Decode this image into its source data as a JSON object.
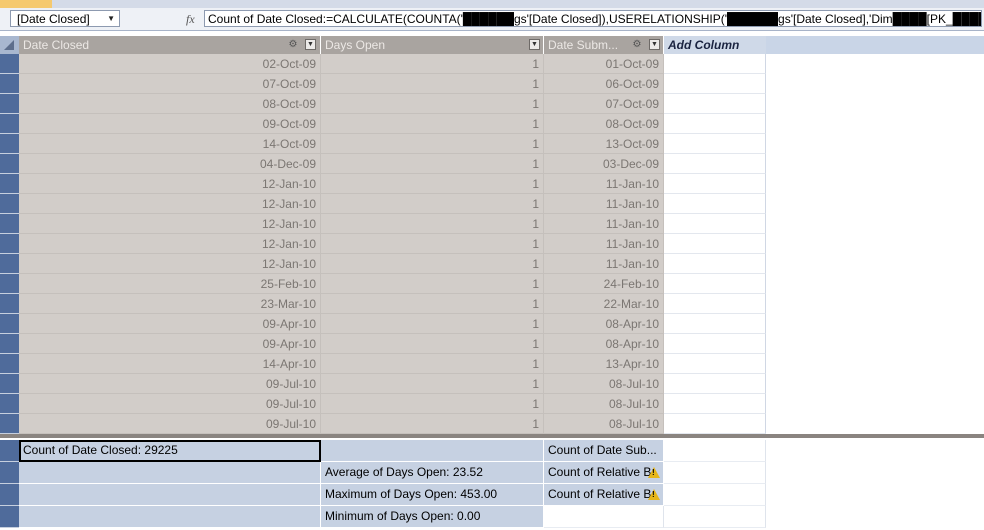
{
  "formula_bar": {
    "name_box": "[Date Closed]",
    "fx_label": "fx",
    "formula": "Count of Date Closed:=CALCULATE(COUNTA('██████gs'[Date Closed]),USERELATIONSHIP('██████gs'[Date Closed],'Dim████[PK_████]))"
  },
  "columns": [
    {
      "label": "Date Closed"
    },
    {
      "label": "Days Open"
    },
    {
      "label": "Date Subm..."
    },
    {
      "label": "Add Column"
    }
  ],
  "rows": [
    {
      "date_closed": "02-Oct-09",
      "days_open": "1",
      "date_submitted": "01-Oct-09"
    },
    {
      "date_closed": "07-Oct-09",
      "days_open": "1",
      "date_submitted": "06-Oct-09"
    },
    {
      "date_closed": "08-Oct-09",
      "days_open": "1",
      "date_submitted": "07-Oct-09"
    },
    {
      "date_closed": "09-Oct-09",
      "days_open": "1",
      "date_submitted": "08-Oct-09"
    },
    {
      "date_closed": "14-Oct-09",
      "days_open": "1",
      "date_submitted": "13-Oct-09"
    },
    {
      "date_closed": "04-Dec-09",
      "days_open": "1",
      "date_submitted": "03-Dec-09"
    },
    {
      "date_closed": "12-Jan-10",
      "days_open": "1",
      "date_submitted": "11-Jan-10"
    },
    {
      "date_closed": "12-Jan-10",
      "days_open": "1",
      "date_submitted": "11-Jan-10"
    },
    {
      "date_closed": "12-Jan-10",
      "days_open": "1",
      "date_submitted": "11-Jan-10"
    },
    {
      "date_closed": "12-Jan-10",
      "days_open": "1",
      "date_submitted": "11-Jan-10"
    },
    {
      "date_closed": "12-Jan-10",
      "days_open": "1",
      "date_submitted": "11-Jan-10"
    },
    {
      "date_closed": "25-Feb-10",
      "days_open": "1",
      "date_submitted": "24-Feb-10"
    },
    {
      "date_closed": "23-Mar-10",
      "days_open": "1",
      "date_submitted": "22-Mar-10"
    },
    {
      "date_closed": "09-Apr-10",
      "days_open": "1",
      "date_submitted": "08-Apr-10"
    },
    {
      "date_closed": "09-Apr-10",
      "days_open": "1",
      "date_submitted": "08-Apr-10"
    },
    {
      "date_closed": "14-Apr-10",
      "days_open": "1",
      "date_submitted": "13-Apr-10"
    },
    {
      "date_closed": "09-Jul-10",
      "days_open": "1",
      "date_submitted": "08-Jul-10"
    },
    {
      "date_closed": "09-Jul-10",
      "days_open": "1",
      "date_submitted": "08-Jul-10"
    },
    {
      "date_closed": "09-Jul-10",
      "days_open": "1",
      "date_submitted": "08-Jul-10"
    }
  ],
  "measures": [
    {
      "date_closed": "Count of Date Closed: 29225",
      "days_open": "",
      "date_submitted": "Count of Date Sub...",
      "warning": false
    },
    {
      "date_closed": "",
      "days_open": "Average of Days Open: 23.52",
      "date_submitted": "Count of Relative B",
      "warning": true
    },
    {
      "date_closed": "",
      "days_open": "Maximum of Days Open: 453.00",
      "date_submitted": "Count of Relative B",
      "warning": true
    },
    {
      "date_closed": "",
      "days_open": "Minimum of Days Open: 0.00",
      "date_submitted": "",
      "warning": false
    }
  ],
  "warning_icon": "warning-icon",
  "colors": {
    "row_selector": "#4f6b9b",
    "data_cell": "#d2cdc9",
    "header_grey": "#a9a4a0",
    "measure_cell": "#c6d1e2"
  }
}
